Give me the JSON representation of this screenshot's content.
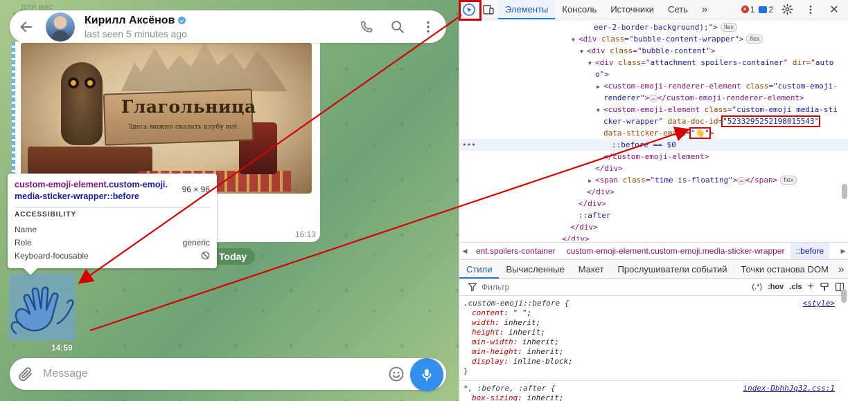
{
  "chat": {
    "faded_top_text": "для вас",
    "peer_name": "Кирилл Аксёнов",
    "peer_status": "last seen 5 minutes ago",
    "image_title": "Глагольница",
    "image_subtitle": "Здесь можно сказать клубу всё.",
    "image_time": "16:13",
    "date_chip": "Today",
    "sticker_time": "14:59",
    "composer_placeholder": "Message",
    "icons": [
      "back-arrow-icon",
      "phone-icon",
      "search-icon",
      "more-vertical-icon",
      "paperclip-icon",
      "emoji-smile-icon",
      "microphone-icon",
      "waving-hands-sticker"
    ],
    "colors": {
      "accent": "#3390ec",
      "date_chip": "#4e8750"
    }
  },
  "tooltip": {
    "selector_tag": "custom-emoji-element",
    "selector_class": ".custom-emoji.",
    "selector_rest": "media-sticker-wrapper::before",
    "size": "96 × 96",
    "section": "ACCESSIBILITY",
    "rows": [
      {
        "label": "Name",
        "value": ""
      },
      {
        "label": "Role",
        "value": "generic"
      },
      {
        "label": "Keyboard-focusable",
        "value": ""
      }
    ]
  },
  "devtools": {
    "tabs": [
      "Элементы",
      "Консоль",
      "Источники",
      "Сеть"
    ],
    "error_count": "1",
    "message_count": "2",
    "dom": {
      "l1": "eer-2-border-background);\">",
      "l2_tag": "<div class=\"",
      "l2_val": "bubble-content-wrapper",
      "l3_val": "bubble-content",
      "l4_val": "attachment spoilers-container",
      "l4_attr2": " dir=",
      "l4_val2": "\"auto",
      "l5": "o\">",
      "l6_tag": "<custom-emoji-renderer-element",
      "l6_val": "\"custom-emoji-",
      "l7_val": "renderer\"",
      "l7_end": "</custom-emoji-renderer-element>",
      "l8_tag": "<custom-emoji-element",
      "l8_val": "\"custom-emoji media-sti",
      "l9_val": "cker-wrapper\"",
      "l9_attr": " data-doc-id=",
      "doc_id": "\"5233295252198015543\"",
      "l10_attr": "data-sticker-emoji=",
      "l10_val": "\"👋\"",
      "l11": "::before == $0",
      "l12": "</custom-emoji-element>",
      "l13": "</div>",
      "l14_tag": "<span class=\"",
      "l14_val": "time is-floating",
      "l14_end": "</span>",
      "l15": "</div>",
      "l16": "</div>",
      "l17": "::after",
      "l18": "</div>",
      "l19": "</div>",
      "flex": "flex",
      "dots": "…"
    },
    "breadcrumbs": [
      "ent.spoilers-container",
      "custom-emoji-element.custom-emoji.media-sticker-wrapper",
      "::before"
    ],
    "style_tabs": [
      "Стили",
      "Вычисленные",
      "Макет",
      "Прослушиватели событий",
      "Точки останова DOM"
    ],
    "filter_placeholder": "Фильтр",
    "filter_tools": {
      "pseudo": ":hov",
      "cls": ".cls",
      "regex": "(.*)"
    },
    "rule1": {
      "selector": ".custom-emoji::before {",
      "source": "<style>",
      "props": [
        {
          "name": "content",
          "value": "\" \";"
        },
        {
          "name": "width",
          "value": "inherit;"
        },
        {
          "name": "height",
          "value": "inherit;"
        },
        {
          "name": "min-width",
          "value": "inherit;"
        },
        {
          "name": "min-height",
          "value": "inherit;"
        },
        {
          "name": "display",
          "value": "inline-block;"
        }
      ],
      "close": "}"
    },
    "rule2": {
      "selector": "*, :before, :after {",
      "source": "index-DbhhJq32.css:1",
      "props": [
        {
          "name": "box-sizing",
          "value": "inherit;"
        }
      ]
    }
  }
}
